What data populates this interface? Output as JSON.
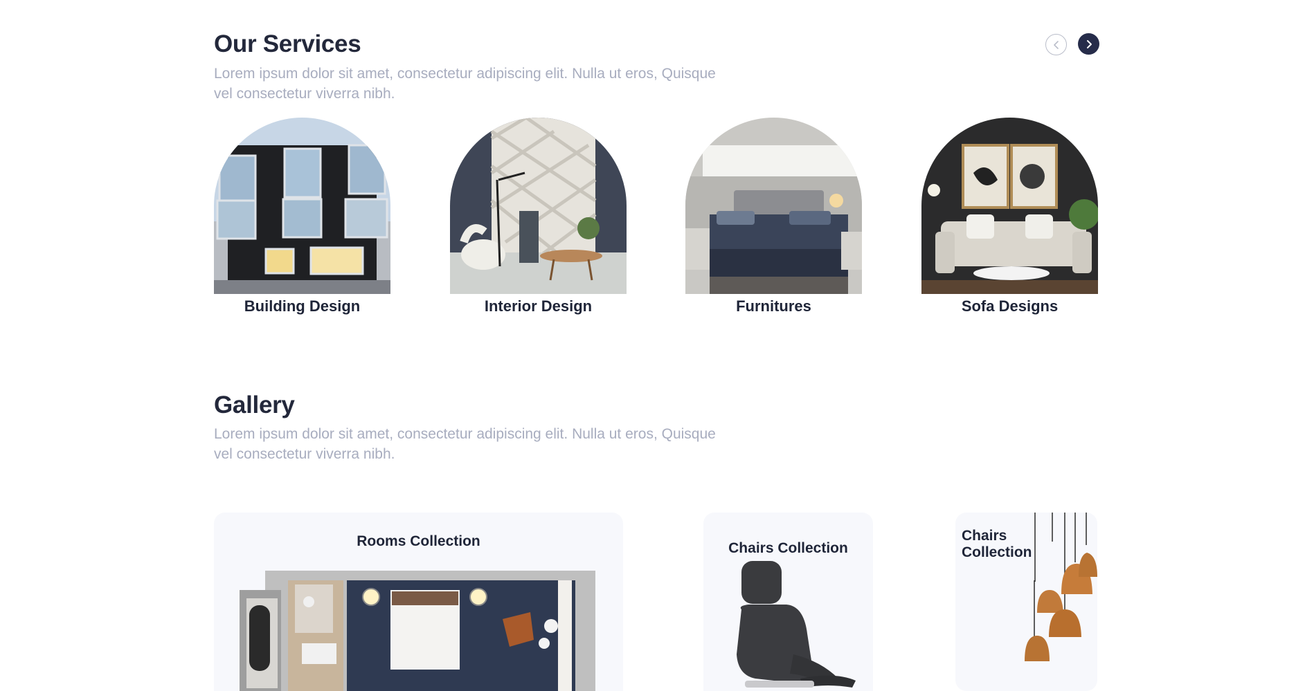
{
  "services": {
    "title": "Our Services",
    "description": "Lorem ipsum dolor sit amet, consectetur adipiscing elit. Nulla ut eros, Quisque vel consectetur viverra nibh.",
    "prev_icon": "chevron-left-icon",
    "next_icon": "chevron-right-icon",
    "items": [
      {
        "label": "Building Design"
      },
      {
        "label": "Interior Design"
      },
      {
        "label": "Furnitures"
      },
      {
        "label": "Sofa Designs"
      }
    ]
  },
  "gallery": {
    "title": "Gallery",
    "description": "Lorem ipsum dolor sit amet, consectetur adipiscing elit. Nulla ut eros, Quisque vel consectetur viverra nibh.",
    "cards": [
      {
        "title": "Rooms Collection"
      },
      {
        "title": "Chairs Collection"
      },
      {
        "title": "Chairs Collection"
      }
    ]
  },
  "colors": {
    "heading": "#23283b",
    "muted_text": "#a8adbf",
    "accent_dark": "#262c4a",
    "card_background": "#f7f8fc"
  }
}
